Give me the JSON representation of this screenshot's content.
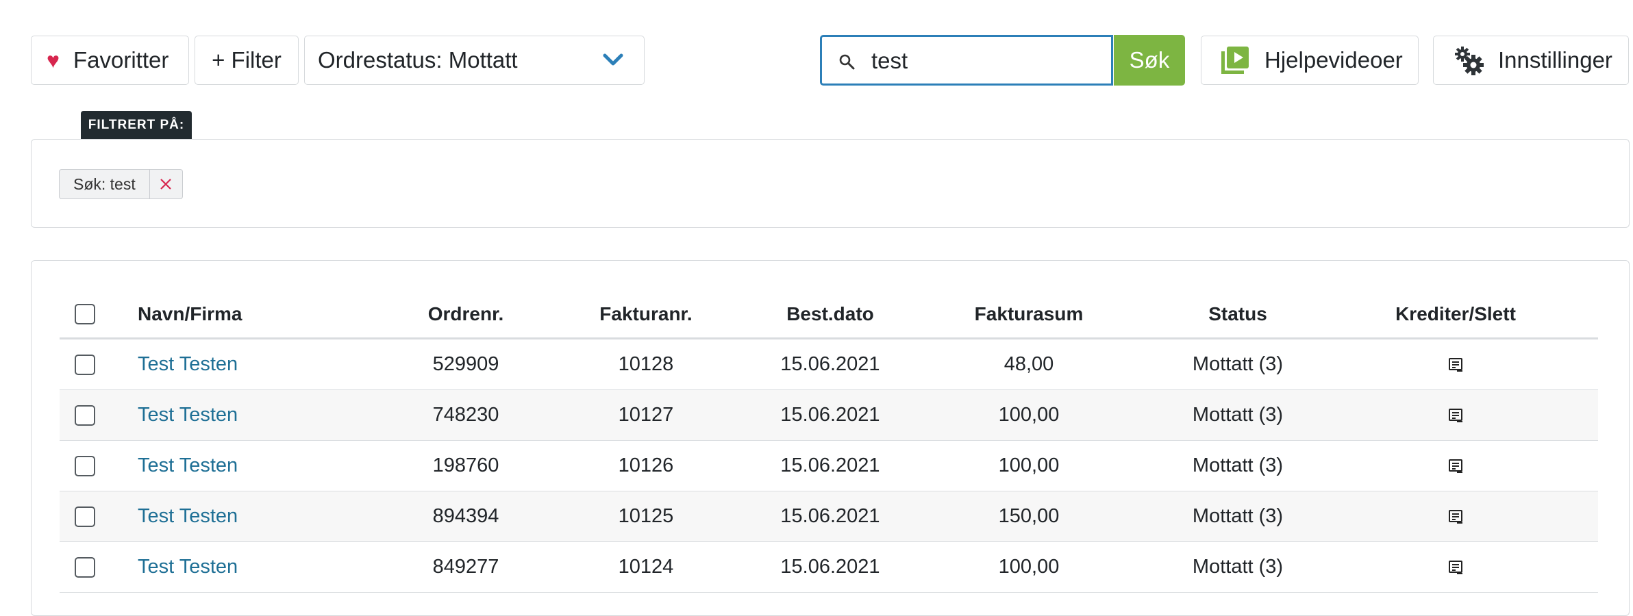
{
  "toolbar": {
    "favorites_label": "Favoritter",
    "filter_label": "+ Filter",
    "order_status_label": "Ordrestatus: Mottatt",
    "search_value": "test",
    "search_button_label": "Søk",
    "help_videos_label": "Hjelpevideoer",
    "settings_label": "Innstillinger"
  },
  "filter_panel": {
    "tag": "FILTRERT PÅ:",
    "chips": [
      {
        "label": "Søk: test"
      }
    ]
  },
  "table": {
    "columns": [
      "Navn/Firma",
      "Ordrenr.",
      "Fakturanr.",
      "Best.dato",
      "Fakturasum",
      "Status",
      "Krediter/Slett"
    ],
    "rows": [
      {
        "name": "Test Testen",
        "order_no": "529909",
        "invoice_no": "10128",
        "date": "15.06.2021",
        "sum": "48,00",
        "status": "Mottatt (3)"
      },
      {
        "name": "Test Testen",
        "order_no": "748230",
        "invoice_no": "10127",
        "date": "15.06.2021",
        "sum": "100,00",
        "status": "Mottatt (3)"
      },
      {
        "name": "Test Testen",
        "order_no": "198760",
        "invoice_no": "10126",
        "date": "15.06.2021",
        "sum": "100,00",
        "status": "Mottatt (3)"
      },
      {
        "name": "Test Testen",
        "order_no": "894394",
        "invoice_no": "10125",
        "date": "15.06.2021",
        "sum": "150,00",
        "status": "Mottatt (3)"
      },
      {
        "name": "Test Testen",
        "order_no": "849277",
        "invoice_no": "10124",
        "date": "15.06.2021",
        "sum": "100,00",
        "status": "Mottatt (3)"
      }
    ]
  },
  "icons": {
    "favorites": "heart-icon",
    "order_status": "chevron-down-icon",
    "search": "search-icon",
    "help_videos": "video-library-icon",
    "settings": "gears-icon",
    "remove_chip": "close-icon",
    "row_action": "credit-note-icon"
  },
  "colors": {
    "accent": "#2c7fb8",
    "search_button": "#7db542",
    "heart": "#d7264e",
    "link": "#1e6f95",
    "tag_bg": "#222b30"
  }
}
